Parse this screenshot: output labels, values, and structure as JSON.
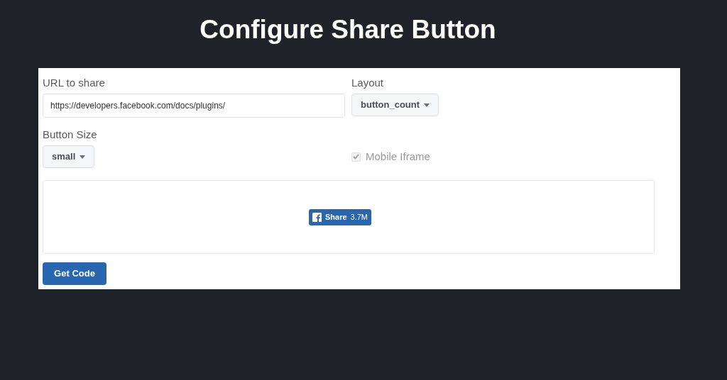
{
  "heading": "Configure Share Button",
  "form": {
    "url": {
      "label": "URL to share",
      "value": "https://developers.facebook.com/docs/plugins/"
    },
    "layout": {
      "label": "Layout",
      "value": "button_count"
    },
    "button_size": {
      "label": "Button Size",
      "value": "small"
    },
    "mobile_iframe": {
      "label": "Mobile Iframe",
      "checked": true,
      "disabled": true
    }
  },
  "preview": {
    "share_button": {
      "label": "Share",
      "count": "3.7M"
    }
  },
  "get_code_button": "Get Code"
}
